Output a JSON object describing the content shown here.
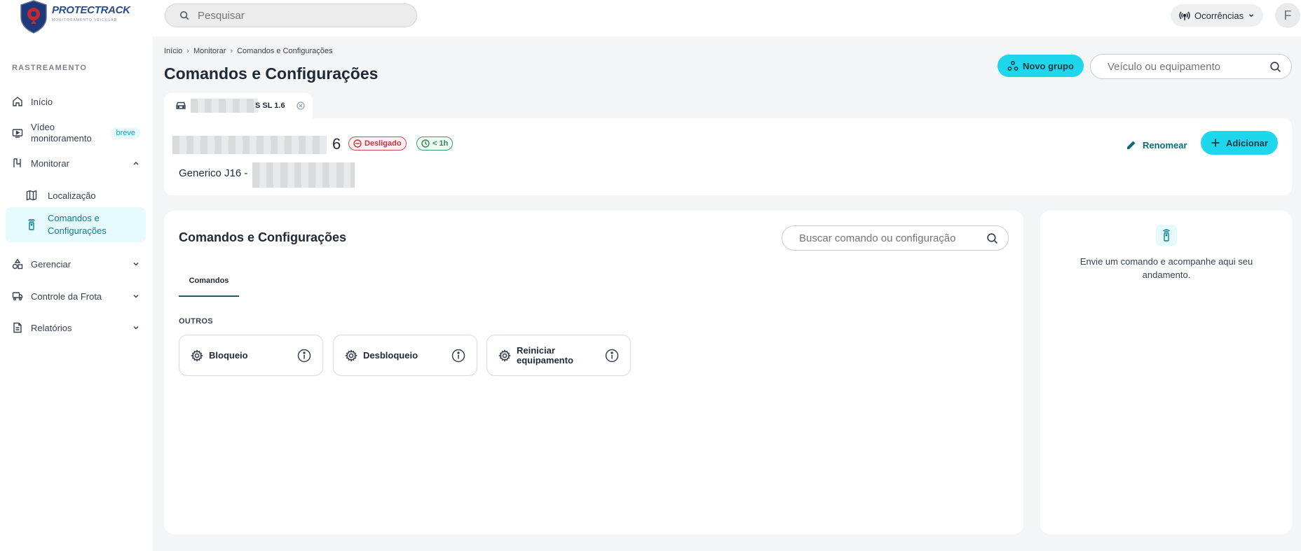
{
  "logo": {
    "name": "PROTECTRACK",
    "tagline": "MONITORAMENTO VEICULAR"
  },
  "search": {
    "placeholder": "Pesquisar"
  },
  "topbar": {
    "ocorrencias_label": "Ocorrências",
    "avatar_letter": "F"
  },
  "sidebar": {
    "section_title": "RASTREAMENTO",
    "items": [
      {
        "label": "Início",
        "icon": "home-icon"
      },
      {
        "label": "Vídeo monitoramento",
        "icon": "video-icon",
        "badge": "breve"
      },
      {
        "label": "Monitorar",
        "icon": "monitor-icon",
        "expanded": true
      },
      {
        "label": "Gerenciar",
        "icon": "shapes-icon"
      },
      {
        "label": "Controle da Frota",
        "icon": "fleet-icon"
      },
      {
        "label": "Relatórios",
        "icon": "report-icon"
      }
    ],
    "subitems": [
      {
        "label": "Localização",
        "icon": "map-icon"
      },
      {
        "label": "Comandos e Configurações",
        "icon": "remote-icon",
        "active": true
      }
    ]
  },
  "breadcrumb": [
    "Início",
    "Monitorar",
    "Comandos e Configurações"
  ],
  "page_title": "Comandos e Configurações",
  "header": {
    "new_group_label": "Novo grupo",
    "vehicle_search_placeholder": "Veículo ou equipamento"
  },
  "vehicle_tab": {
    "label": "S SL 1.6"
  },
  "vehicle": {
    "name_suffix": "6",
    "status": "Desligado",
    "last_update": "< 1h",
    "model_prefix": "Generico J16 -",
    "rename_label": "Renomear",
    "add_label": "Adicionar"
  },
  "commands": {
    "title": "Comandos e Configurações",
    "search_placeholder": "Buscar comando ou configuração",
    "tab_label": "Comandos",
    "group_label": "OUTROS",
    "items": [
      {
        "label": "Bloqueio"
      },
      {
        "label": "Desbloqueio"
      },
      {
        "label": "Reiniciar equipamento"
      }
    ]
  },
  "side_panel": {
    "message": "Envie um comando e acompanhe aqui seu andamento."
  },
  "colors": {
    "accent": "#1fd7ec",
    "danger": "#c23541",
    "success": "#2f855a",
    "active_bg": "#e6fbfd"
  }
}
